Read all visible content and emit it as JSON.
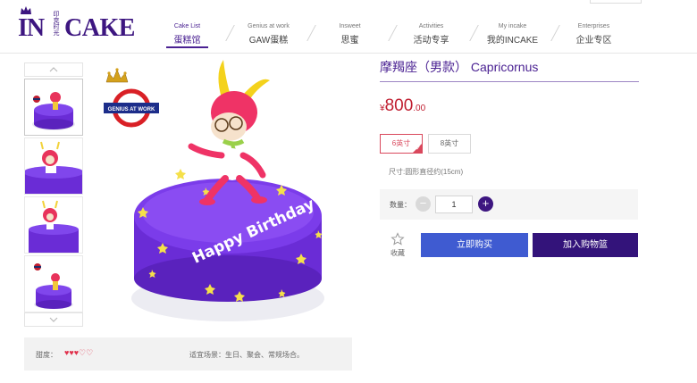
{
  "brand": {
    "logo_prefix": "IN",
    "logo_cn": "印克时光",
    "logo_suffix": "CAKE"
  },
  "nav": [
    {
      "en": "Cake List",
      "cn": "蛋糕馆",
      "active": true
    },
    {
      "en": "Genius at work",
      "cn": "GAW蛋糕",
      "active": false
    },
    {
      "en": "Insweet",
      "cn": "思蜜",
      "active": false
    },
    {
      "en": "Activities",
      "cn": "活动专享",
      "active": false
    },
    {
      "en": "My incake",
      "cn": "我的INCAKE",
      "active": false
    },
    {
      "en": "Enterprises",
      "cn": "企业专区",
      "active": false
    }
  ],
  "gallery": {
    "badge_text": "GENIUS AT WORK",
    "cake_text": "Happy Birthday"
  },
  "product": {
    "title": "摩羯座（男款） Capricornus",
    "price": {
      "currency": "¥",
      "integer": "800",
      "decimal": ".00"
    },
    "sizes": [
      {
        "label": "6英寸",
        "selected": true
      },
      {
        "label": "8英寸",
        "selected": false
      }
    ],
    "size_desc": "尺寸:圆形直径约(15cm)",
    "quantity_label": "数量：",
    "quantity": "1",
    "favorite_label": "收藏",
    "buy_now": "立即购买",
    "add_to_cart": "加入购物篮"
  },
  "info_bar": {
    "sweetness_label": "甜度：",
    "sweetness_rating": 3,
    "sweetness_max": 5,
    "filled_hearts": "♥♥♥",
    "empty_hearts": "♡♡",
    "occasion": "适宜场景：生日、聚会、常规场合。"
  },
  "colors": {
    "brand_purple": "#3d1680",
    "price_red": "#c01e30",
    "buy_blue": "#3f5bd1",
    "cart_purple": "#33137a",
    "cake_purple": "#6a2cd6"
  }
}
